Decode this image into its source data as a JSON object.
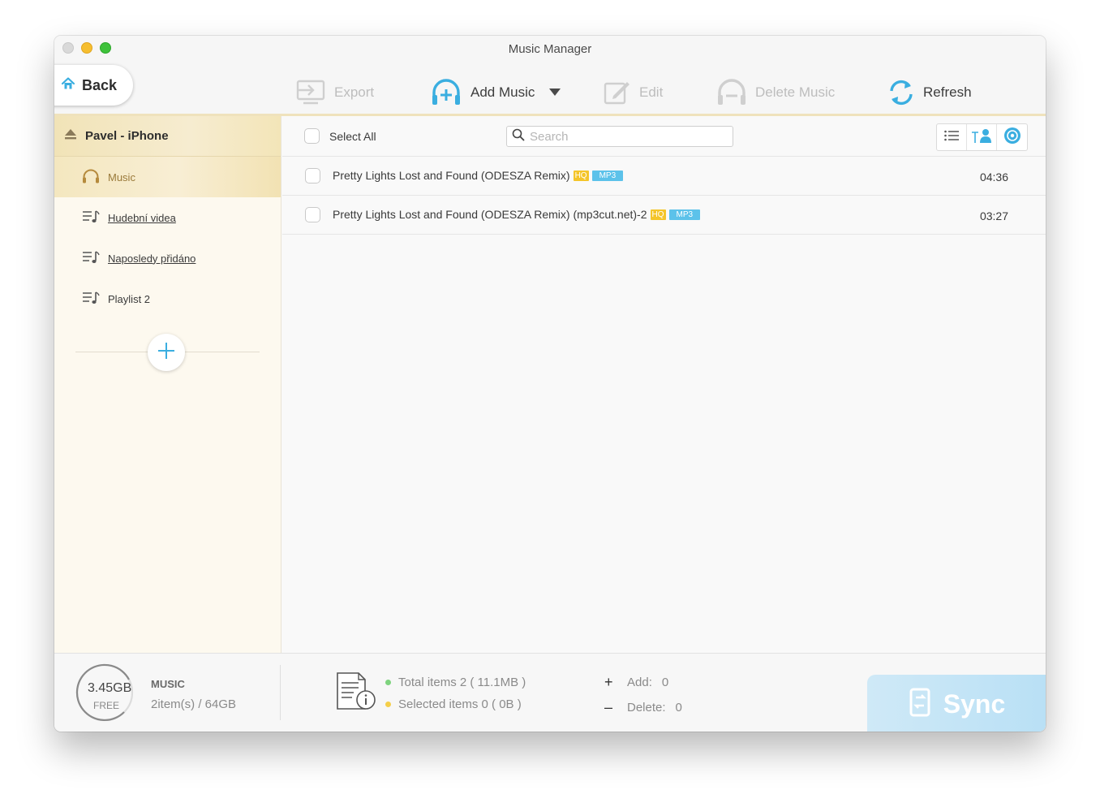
{
  "window": {
    "title": "Music Manager"
  },
  "toolbar": {
    "back_label": "Back",
    "export_label": "Export",
    "add_music_label": "Add Music",
    "edit_label": "Edit",
    "delete_label": "Delete Music",
    "refresh_label": "Refresh"
  },
  "sidebar": {
    "device_name": "Pavel - iPhone",
    "items": [
      {
        "label": "Music",
        "icon": "headphones-icon",
        "selected": true
      },
      {
        "label": "Hudební videa",
        "icon": "playlist-icon"
      },
      {
        "label": "Naposledy přidáno",
        "icon": "playlist-icon"
      },
      {
        "label": "Playlist 2",
        "icon": "playlist-icon"
      }
    ]
  },
  "list": {
    "select_all_label": "Select All",
    "search_placeholder": "Search",
    "rows": [
      {
        "title": "Pretty Lights  Lost and Found (ODESZA Remix)",
        "hq": "HQ",
        "format": "MP3",
        "duration": "04:36"
      },
      {
        "title": "Pretty Lights Lost and Found (ODESZA Remix) (mp3cut.net)-2",
        "hq": "HQ",
        "format": "MP3",
        "duration": "03:27"
      }
    ]
  },
  "footer": {
    "free_space": "3.45GB",
    "free_label": "FREE",
    "category": "MUSIC",
    "count": "2item(s) / 64GB",
    "total_items": "Total items 2 ( 11.1MB )",
    "selected_items": "Selected items 0 ( 0B )",
    "add_label": "Add:",
    "add_value": "0",
    "delete_label": "Delete:",
    "delete_value": "0",
    "sync_label": "Sync"
  },
  "colors": {
    "accent": "#3aaee0",
    "sidebar_selected": "#f4e7bf",
    "hq_badge": "#f4c52a",
    "mp3_badge": "#5cc2ea",
    "total_dot": "#7ed37e",
    "selected_dot": "#f5cf4a"
  }
}
